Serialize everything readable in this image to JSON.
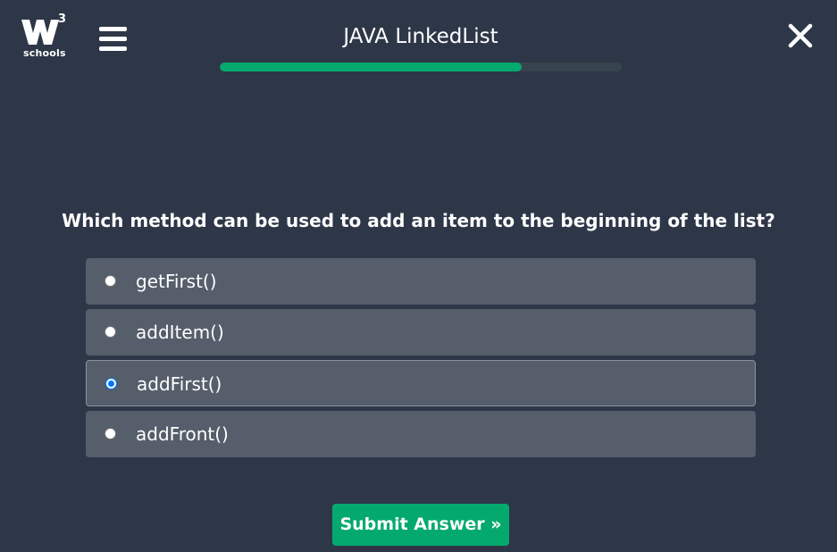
{
  "header": {
    "logo_superscript": "3",
    "logo_word": "schools",
    "title": "JAVA LinkedList",
    "progress_fraction": 0.75
  },
  "quiz": {
    "question": "Which method can be used to add an item to the beginning of the list?",
    "options": [
      {
        "label": "getFirst()",
        "selected": false
      },
      {
        "label": "addItem()",
        "selected": false
      },
      {
        "label": "addFirst()",
        "selected": true
      },
      {
        "label": "addFront()",
        "selected": false
      }
    ],
    "submit_label": "Submit Answer »"
  },
  "colors": {
    "background": "#2d3748",
    "accent": "#04aa6d",
    "option_background": "#555e6a",
    "radio_selected": "#0075ff"
  },
  "icons": {
    "logo": "w3schools-logo-icon",
    "menu": "hamburger-menu-icon",
    "close": "close-icon"
  }
}
